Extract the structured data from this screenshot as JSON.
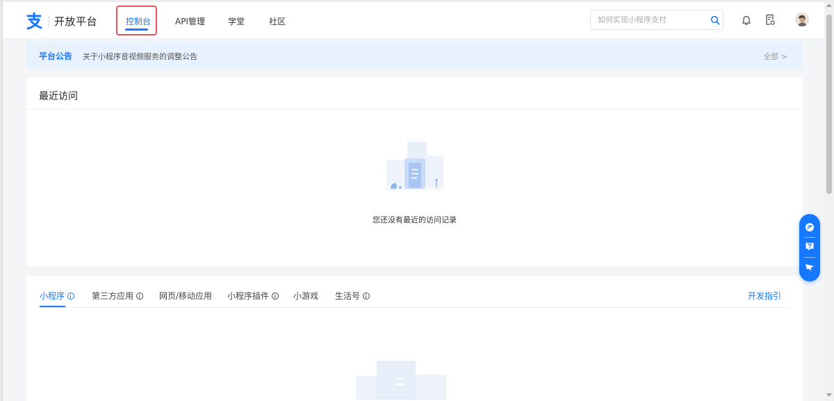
{
  "header": {
    "logo_text": "开放平台",
    "nav": [
      {
        "label": "控制台",
        "active": true
      },
      {
        "label": "API管理",
        "active": false
      },
      {
        "label": "学堂",
        "active": false
      },
      {
        "label": "社区",
        "active": false
      }
    ],
    "search_placeholder": "如何实现小程序支付",
    "icons": [
      "search-icon",
      "bell-icon",
      "document-icon",
      "avatar"
    ]
  },
  "notice": {
    "title": "平台公告",
    "text": "关于小程序音视频服务的调整公告",
    "more": "全部 >"
  },
  "recent": {
    "title": "最近访问",
    "empty_text": "您还没有最近的访问记录"
  },
  "apps": {
    "tabs": [
      {
        "label": "小程序",
        "info": true,
        "active": true
      },
      {
        "label": "第三方应用",
        "info": true,
        "active": false
      },
      {
        "label": "网页/移动应用",
        "info": false,
        "active": false
      },
      {
        "label": "小程序插件",
        "info": true,
        "active": false
      },
      {
        "label": "小游戏",
        "info": false,
        "active": false
      },
      {
        "label": "生活号",
        "info": true,
        "active": false
      }
    ],
    "dev_guide": "开发指引"
  },
  "float_tools": [
    "chat-icon",
    "help-icon",
    "feedback-icon"
  ],
  "colors": {
    "accent": "#1677ff",
    "highlight_box": "#e8515d",
    "notice_bg": "#e8f1fe",
    "page_bg": "#f4f5f7"
  }
}
